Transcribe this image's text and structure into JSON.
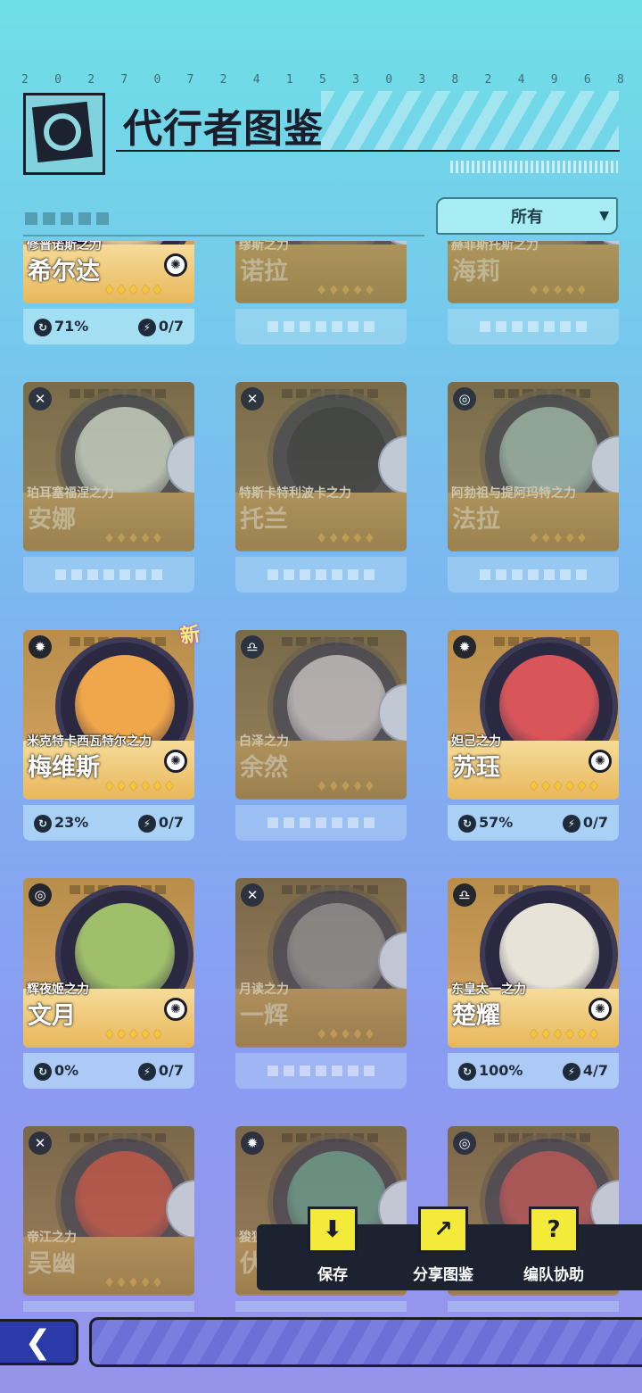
{
  "header": {
    "serial_digits": [
      "2",
      "0",
      "2",
      "7",
      "0",
      "7",
      "2",
      "4",
      "1",
      "5",
      "3",
      "0",
      "3",
      "8",
      "2",
      "4",
      "9",
      "6",
      "8"
    ],
    "title": "代行者图鉴",
    "filter_label": "所有",
    "filter_arrow": "▼"
  },
  "cards": [
    {
      "subtitle": "修普诺斯之力",
      "name": "希尔达",
      "owned": true,
      "element": "wheel",
      "progress": "71%",
      "fragments": "0/7",
      "stars": "♦♦♦♦♦",
      "stars_count": 5
    },
    {
      "subtitle": "缪斯之力",
      "name": "诺拉",
      "owned": false,
      "element": "",
      "stars": "♦♦♦♦♦"
    },
    {
      "subtitle": "赫菲斯托斯之力",
      "name": "海莉",
      "owned": false,
      "element": "",
      "stars": "♦♦♦♦♦"
    },
    {
      "subtitle": "珀耳塞福涅之力",
      "name": "安娜",
      "owned": false,
      "element": "✕",
      "stars": "♦♦♦♦♦"
    },
    {
      "subtitle": "特斯卡特利波卡之力",
      "name": "托兰",
      "owned": false,
      "element": "✕",
      "stars": "♦♦♦♦♦"
    },
    {
      "subtitle": "阿勃祖与提阿玛特之力",
      "name": "法拉",
      "owned": false,
      "element": "◎",
      "stars": "♦♦♦♦♦"
    },
    {
      "subtitle": "米克特卡西瓦特尔之力",
      "name": "梅维斯",
      "owned": true,
      "element": "✹",
      "progress": "23%",
      "fragments": "0/7",
      "stars": "♦♦♦♦♦♦",
      "new_tag": "新"
    },
    {
      "subtitle": "白泽之力",
      "name": "余然",
      "owned": false,
      "element": "♎",
      "stars": "♦♦♦♦♦"
    },
    {
      "subtitle": "妲己之力",
      "name": "苏珏",
      "owned": true,
      "element": "✹",
      "progress": "57%",
      "fragments": "0/7",
      "stars": "♦♦♦♦♦♦"
    },
    {
      "subtitle": "辉夜姬之力",
      "name": "文月",
      "owned": true,
      "element": "◎",
      "progress": "0%",
      "fragments": "0/7",
      "stars": "♦♦♦♦♦"
    },
    {
      "subtitle": "月读之力",
      "name": "一辉",
      "owned": false,
      "element": "✕",
      "stars": "♦♦♦♦♦"
    },
    {
      "subtitle": "东皇太一之力",
      "name": "楚耀",
      "owned": true,
      "element": "♎",
      "progress": "100%",
      "fragments": "4/7",
      "stars": "♦♦♦♦♦♦"
    },
    {
      "subtitle": "帝江之力",
      "name": "吴幽",
      "owned": false,
      "element": "✕",
      "stars": "♦♦♦♦♦"
    },
    {
      "subtitle": "狻猊",
      "name": "伏",
      "owned": false,
      "element": "✹",
      "stars": ""
    },
    {
      "subtitle": "",
      "name": "",
      "owned": false,
      "element": "◎",
      "stars": ""
    }
  ],
  "actions": [
    {
      "label": "保存",
      "icon": "download-folder-icon",
      "glyph": "⬇"
    },
    {
      "label": "分享图鉴",
      "icon": "share-icon",
      "glyph": "↗"
    },
    {
      "label": "编队协助",
      "icon": "cards-icon",
      "glyph": "?"
    }
  ],
  "nav": {
    "back_glyph": "❮"
  },
  "colors": {
    "accent_yellow": "#f4ea3a",
    "gold": "#e9b85c",
    "bg_top": "#6fdfe6",
    "bg_bottom": "#9694ea"
  }
}
